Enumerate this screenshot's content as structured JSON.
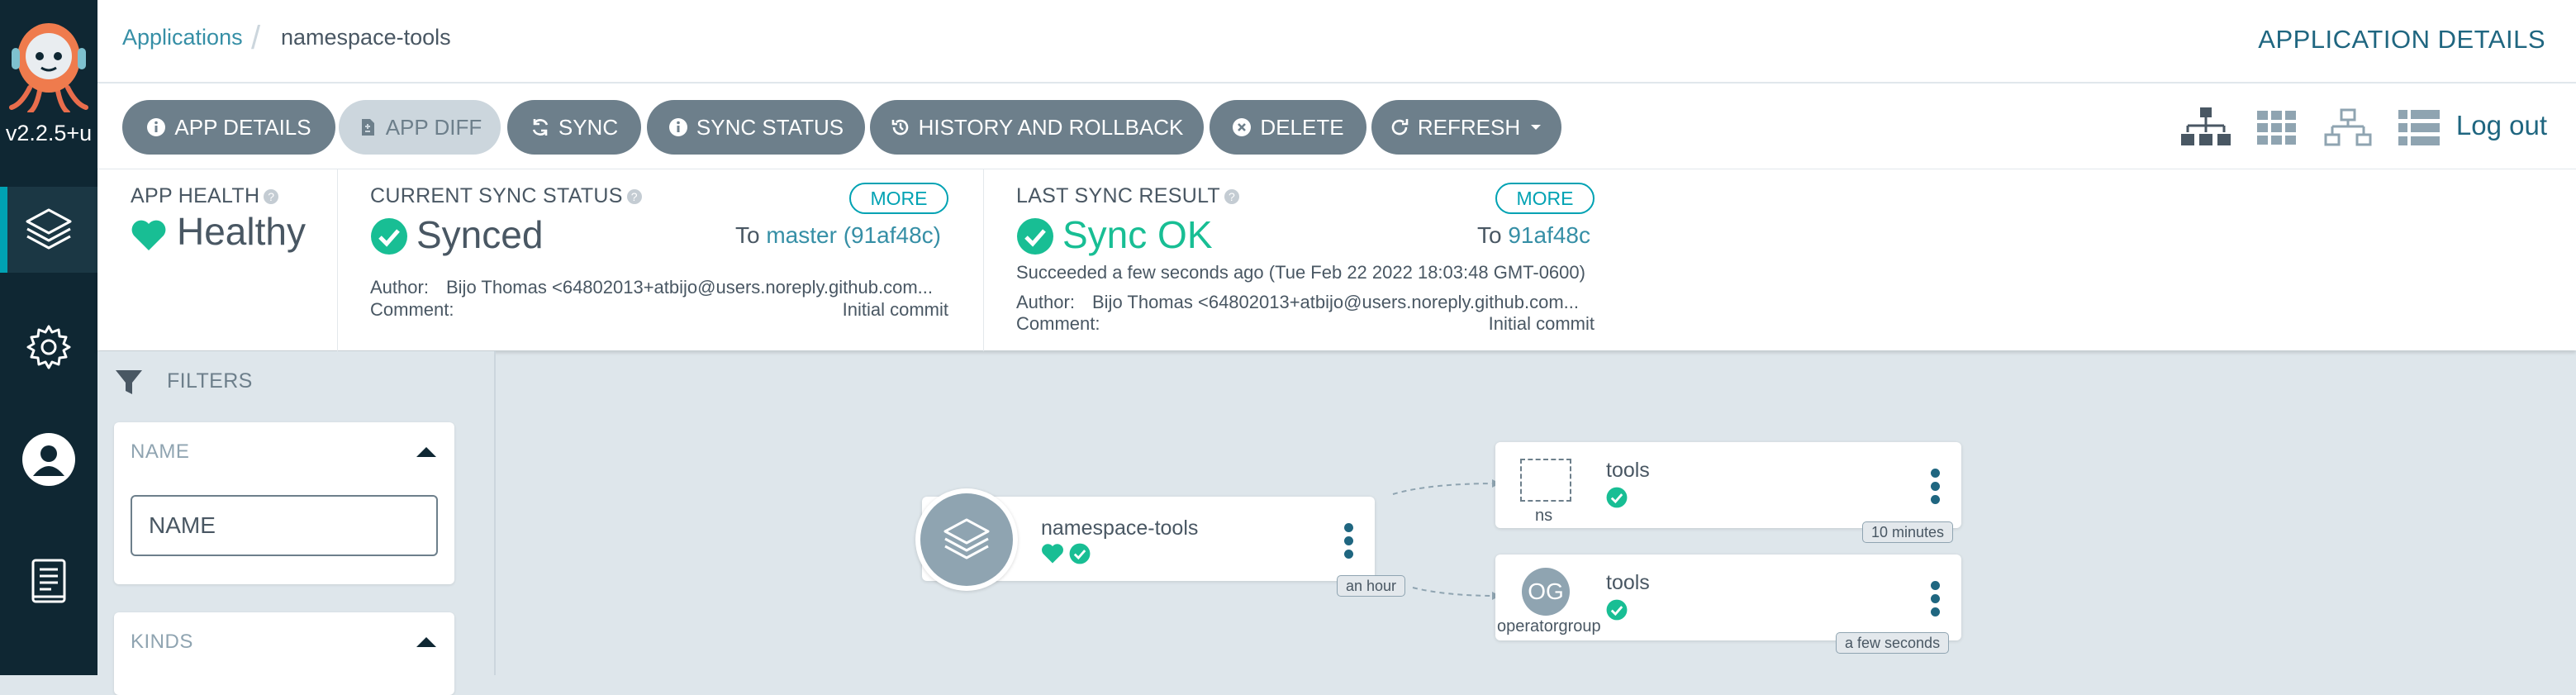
{
  "app": {
    "version": "v2.2.5+u"
  },
  "nav": {
    "items": [
      {
        "icon": "applications-layers-icon",
        "active": true
      },
      {
        "icon": "settings-gear-icon",
        "active": false
      },
      {
        "icon": "user-icon",
        "active": false
      },
      {
        "icon": "docs-book-icon",
        "active": false
      }
    ]
  },
  "header": {
    "breadcrumb_root": "Applications",
    "breadcrumb_current": "namespace-tools",
    "page_title": "APPLICATION DETAILS"
  },
  "toolbar": {
    "buttons": [
      {
        "label": "APP DETAILS",
        "icon": "info-icon",
        "disabled": false
      },
      {
        "label": "APP DIFF",
        "icon": "file-diff-icon",
        "disabled": true
      },
      {
        "label": "SYNC",
        "icon": "sync-icon",
        "disabled": false
      },
      {
        "label": "SYNC STATUS",
        "icon": "info-icon",
        "disabled": false
      },
      {
        "label": "HISTORY AND ROLLBACK",
        "icon": "history-icon",
        "disabled": false
      },
      {
        "label": "DELETE",
        "icon": "times-circle-icon",
        "disabled": false
      },
      {
        "label": "REFRESH",
        "icon": "refresh-icon",
        "disabled": false,
        "dropdown": true
      }
    ],
    "views": [
      "tree-view-icon",
      "pods-view-icon",
      "network-view-icon",
      "list-view-icon"
    ],
    "logout": "Log out"
  },
  "status": {
    "health": {
      "label": "APP HEALTH",
      "value": "Healthy",
      "color": "#18be94"
    },
    "current_sync": {
      "label": "CURRENT SYNC STATUS",
      "value": "Synced",
      "more": "MORE",
      "to_prefix": "To",
      "to_ref": "master (91af48c)",
      "author_label": "Author:",
      "author": "Bijo Thomas <64802013+atbijo@users.noreply.github.com...",
      "comment_label": "Comment:",
      "comment": "Initial commit"
    },
    "last_sync": {
      "label": "LAST SYNC RESULT",
      "value": "Sync OK",
      "more": "MORE",
      "to_prefix": "To",
      "to_ref": "91af48c",
      "succeeded": "Succeeded a few seconds ago (Tue Feb 22 2022 18:03:48 GMT-0600)",
      "author_label": "Author:",
      "author": "Bijo Thomas <64802013+atbijo@users.noreply.github.com...",
      "comment_label": "Comment:",
      "comment": "Initial commit"
    }
  },
  "filters": {
    "title": "FILTERS",
    "name_header": "NAME",
    "name_placeholder": "NAME",
    "kinds_header": "KINDS"
  },
  "graph": {
    "app_node": {
      "name": "namespace-tools",
      "age": "an hour"
    },
    "children": [
      {
        "name": "tools",
        "kind": "ns",
        "age": "10 minutes",
        "icon": "namespace-dashed-box-icon"
      },
      {
        "name": "tools",
        "kind": "operatorgroup",
        "abbr": "OG",
        "age": "a few seconds"
      }
    ]
  },
  "colors": {
    "accent": "#00a2b3",
    "nav_bg": "#0f2733",
    "button_bg": "#6d7f8b",
    "healthy": "#18be94"
  }
}
